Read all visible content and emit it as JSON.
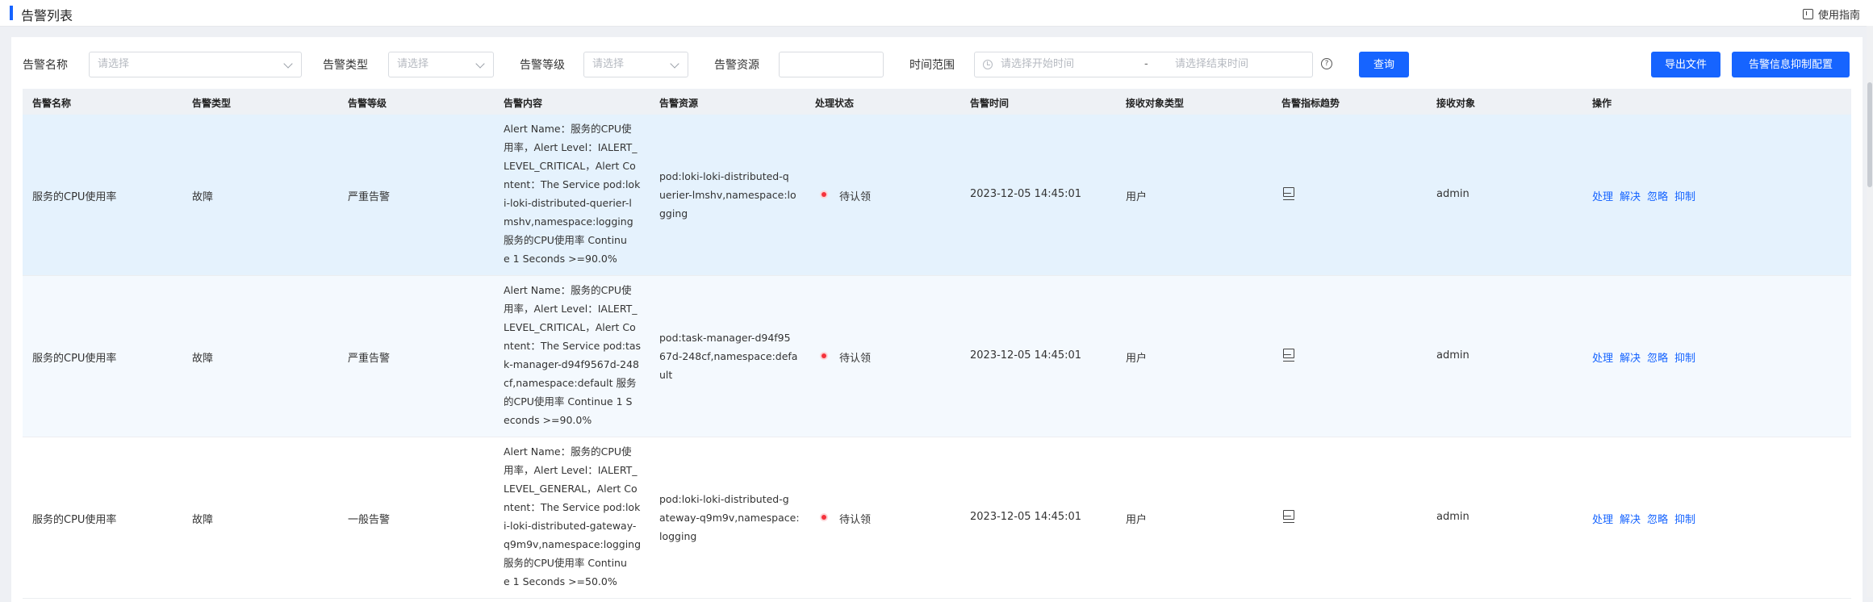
{
  "header": {
    "title": "告警列表",
    "guide_label": "使用指南"
  },
  "filters": {
    "name_label": "告警名称",
    "name_placeholder": "请选择",
    "type_label": "告警类型",
    "type_placeholder": "请选择",
    "level_label": "告警等级",
    "level_placeholder": "请选择",
    "resource_label": "告警资源",
    "resource_value": "",
    "time_label": "时间范围",
    "start_placeholder": "请选择开始时间",
    "separator": "-",
    "end_placeholder": "请选择结束时间",
    "query_button": "查询",
    "export_button": "导出文件",
    "suppress_config_button": "告警信息抑制配置"
  },
  "table": {
    "columns": [
      "告警名称",
      "告警类型",
      "告警等级",
      "告警内容",
      "告警资源",
      "处理状态",
      "告警时间",
      "接收对象类型",
      "告警指标趋势",
      "接收对象",
      "操作"
    ],
    "rows": [
      {
        "name": "服务的CPU使用率",
        "type": "故障",
        "level": "严重告警",
        "content": "Alert Name：服务的CPU使\n用率，Alert Level：IALERT_\nLEVEL_CRITICAL，Alert Co\nntent：The Service pod:lok\ni-loki-distributed-querier-l\nmshv,namespace:logging\n服务的CPU使用率 Continu\ne 1 Seconds >=90.0%",
        "resource": "pod:loki-loki-distributed-q\nuerier-lmshv,namespace:lo\ngging",
        "status": "待认领",
        "time": "2023-12-05 14:45:01",
        "receiver_type": "用户",
        "receiver": "admin",
        "actions": [
          "处理",
          "解决",
          "忽略",
          "抑制"
        ]
      },
      {
        "name": "服务的CPU使用率",
        "type": "故障",
        "level": "严重告警",
        "content": "Alert Name：服务的CPU使\n用率，Alert Level：IALERT_\nLEVEL_CRITICAL，Alert Co\nntent：The Service pod:tas\nk-manager-d94f9567d-248\ncf,namespace:default 服务\n的CPU使用率 Continue 1 S\neconds >=90.0%",
        "resource": "pod:task-manager-d94f95\n67d-248cf,namespace:defa\nult",
        "status": "待认领",
        "time": "2023-12-05 14:45:01",
        "receiver_type": "用户",
        "receiver": "admin",
        "actions": [
          "处理",
          "解决",
          "忽略",
          "抑制"
        ]
      },
      {
        "name": "服务的CPU使用率",
        "type": "故障",
        "level": "一般告警",
        "content": "Alert Name：服务的CPU使\n用率，Alert Level：IALERT_\nLEVEL_GENERAL，Alert Co\nntent：The Service pod:lok\ni-loki-distributed-gateway-\nq9m9v,namespace:logging\n服务的CPU使用率 Continu\ne 1 Seconds >=50.0%",
        "resource": "pod:loki-loki-distributed-g\nateway-q9m9v,namespace:\nlogging",
        "status": "待认领",
        "time": "2023-12-05 14:45:01",
        "receiver_type": "用户",
        "receiver": "admin",
        "actions": [
          "处理",
          "解决",
          "忽略",
          "抑制"
        ]
      }
    ]
  },
  "colors": {
    "accent": "#1664ff",
    "selected_row": "#e5f2fd",
    "alt_row": "#f4f9fe",
    "status_dot": "#f5323c"
  },
  "icons": {
    "guide": "guide-icon",
    "chevron": "chevron-down-icon",
    "clock": "clock-icon",
    "help": "help-icon",
    "trend": "trend-chart-icon",
    "status": "status-dot-icon"
  }
}
